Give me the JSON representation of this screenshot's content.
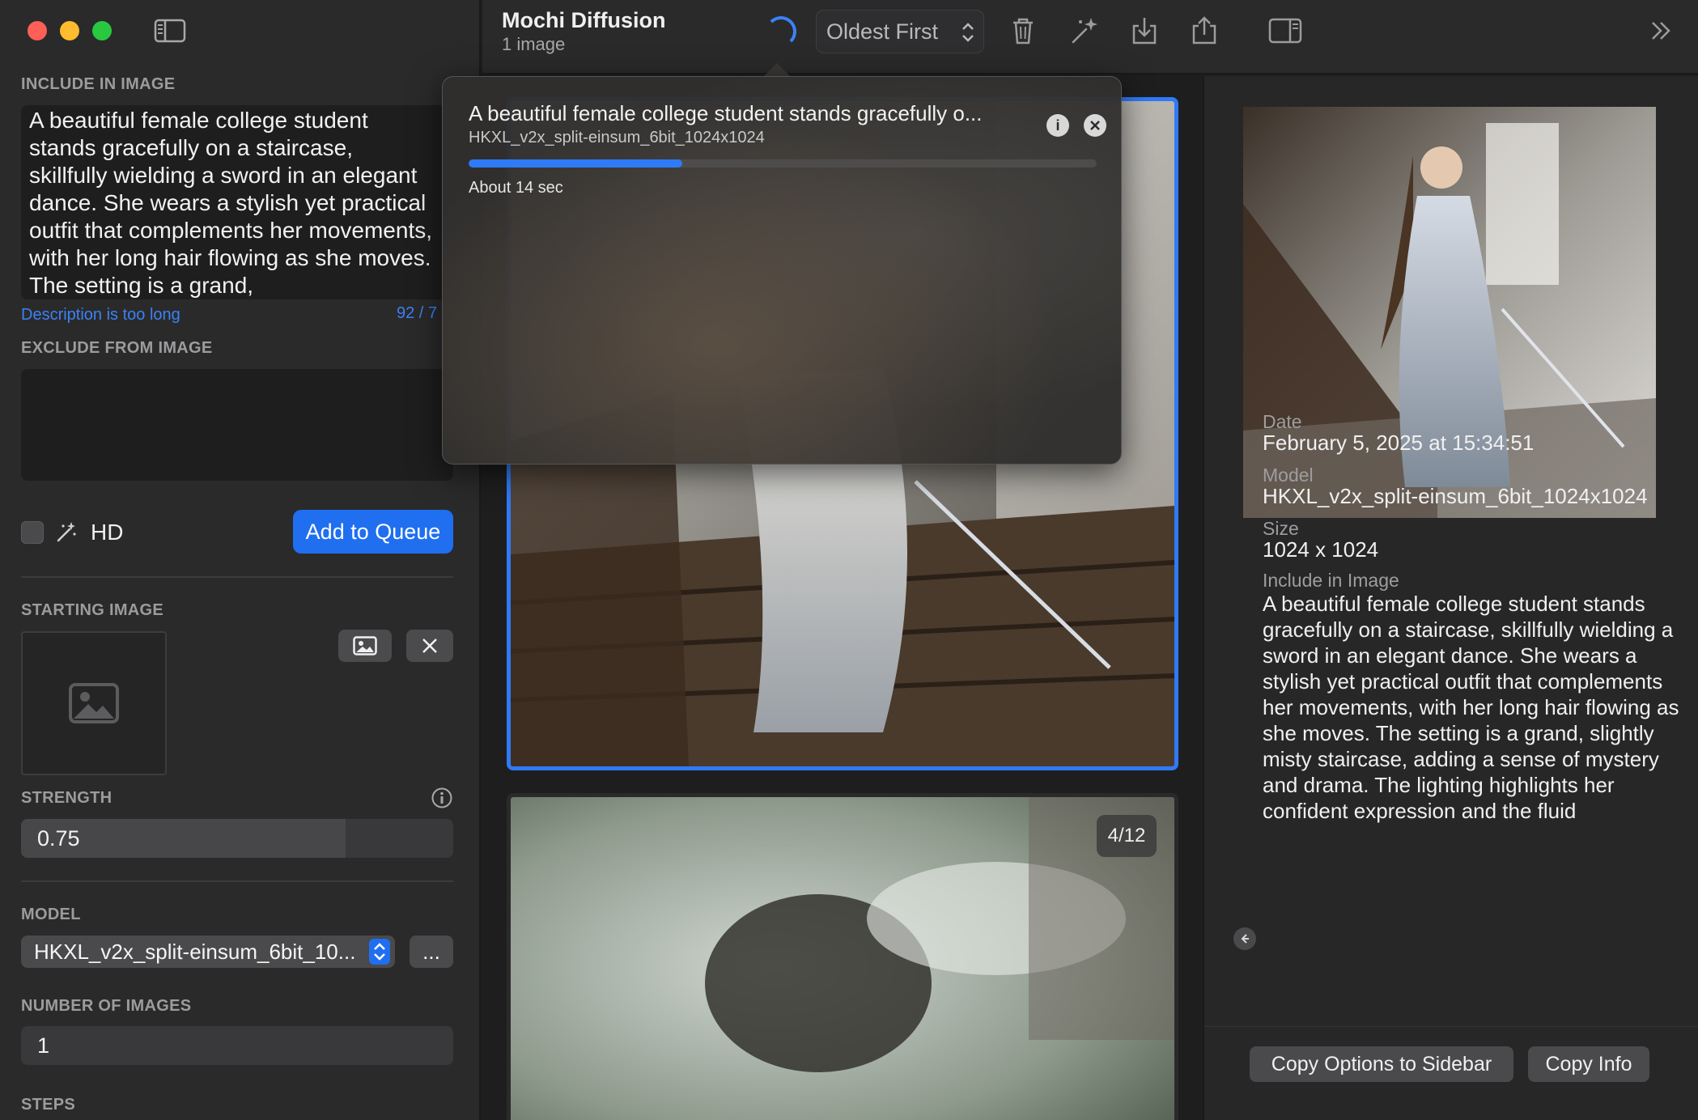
{
  "window": {
    "app_title": "Mochi Diffusion",
    "subtitle": "1 image"
  },
  "sidebar": {
    "include_label": "INCLUDE IN IMAGE",
    "prompt": "A beautiful female college student stands gracefully on a staircase, skillfully wielding a sword in an elegant dance. She wears a stylish yet practical outfit that complements her movements, with her long hair flowing as she moves. The setting is a grand,",
    "prompt_warning": "Description is too long",
    "prompt_count": "92 / 7",
    "exclude_label": "EXCLUDE FROM IMAGE",
    "exclude_value": "",
    "hd_label": "HD",
    "hd_checked": false,
    "add_queue_label": "Add to Queue",
    "starting_image_label": "STARTING IMAGE",
    "strength_label": "STRENGTH",
    "strength_value": "0.75",
    "strength_fraction": 0.75,
    "model_label": "MODEL",
    "model_value": "HKXL_v2x_split-einsum_6bit_10...",
    "more_label": "...",
    "num_images_label": "NUMBER OF IMAGES",
    "num_images_value": "1",
    "steps_label": "STEPS"
  },
  "toolbar": {
    "sort_label": "Oldest First",
    "icons": [
      "trash-icon",
      "magic-wand-icon",
      "download-icon",
      "share-icon",
      "inspector-toggle-icon",
      "chevron-double-right-icon"
    ]
  },
  "gallery": {
    "badge": "4/12"
  },
  "popover": {
    "title": "A beautiful female college student stands gracefully o...",
    "model": "HKXL_v2x_split-einsum_6bit_1024x1024",
    "progress": 0.34,
    "eta": "About 14 sec"
  },
  "inspector": {
    "date_label": "Date",
    "date_value": "February 5, 2025 at 15:34:51",
    "model_label": "Model",
    "model_value": "HKXL_v2x_split-einsum_6bit_1024x1024",
    "size_label": "Size",
    "size_value": "1024 x 1024",
    "include_label": "Include in Image",
    "include_value": "A beautiful female college student stands gracefully on a staircase, skillfully wielding a sword in an elegant dance. She wears a stylish yet practical outfit that complements her movements, with her long hair flowing as she moves. The setting is a grand, slightly misty staircase, adding a sense of mystery and drama. The lighting highlights her confident expression and the fluid",
    "copy_options_label": "Copy Options to Sidebar",
    "copy_info_label": "Copy Info"
  },
  "colors": {
    "accent": "#2f7af6",
    "warning": "#3b82f6",
    "window_bg": "#1e1e1e",
    "sidebar_bg": "#2a2a2b"
  }
}
